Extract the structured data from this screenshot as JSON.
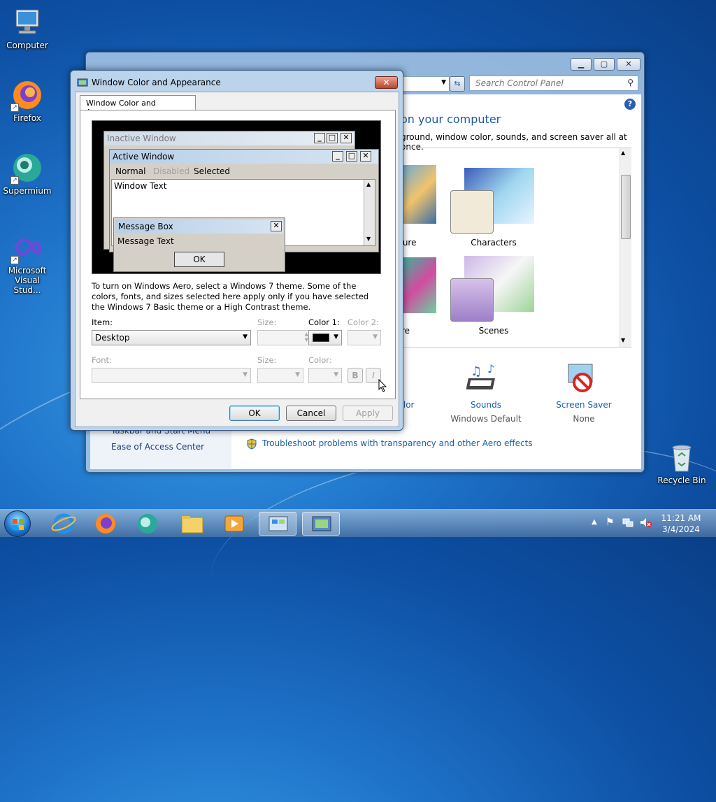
{
  "desktop": {
    "icons": [
      {
        "label": "Computer"
      },
      {
        "label": "Firefox"
      },
      {
        "label": "Supermium"
      },
      {
        "label": "Microsoft Visual Stud..."
      },
      {
        "label": "Recycle Bin"
      }
    ]
  },
  "control_panel": {
    "search_placeholder": "Search Control Panel",
    "heading": "on your computer",
    "subheading": "ground, window color, sounds, and screen saver all at once.",
    "themes": [
      {
        "label": "cture"
      },
      {
        "label": "Characters"
      },
      {
        "label": "re"
      },
      {
        "label": "Scenes"
      }
    ],
    "bottom_items": [
      {
        "title": "olor",
        "sub": ""
      },
      {
        "title": "Sounds",
        "sub": "Windows Default"
      },
      {
        "title": "Screen Saver",
        "sub": "None"
      }
    ],
    "left_links": [
      "Taskbar and Start Menu",
      "Ease of Access Center"
    ],
    "troubleshoot_link": "Troubleshoot problems with transparency and other Aero effects"
  },
  "dialog": {
    "title": "Window Color and Appearance",
    "tab_label": "Window Color and Appearance",
    "preview": {
      "inactive_title": "Inactive Window",
      "active_title": "Active Window",
      "menu_normal": "Normal",
      "menu_disabled": "Disabled",
      "menu_selected": "Selected",
      "window_text": "Window Text",
      "msgbox_title": "Message Box",
      "msgbox_text": "Message Text",
      "ok": "OK"
    },
    "description": "To turn on Windows Aero, select a Windows 7 theme.  Some of the colors, fonts, and sizes selected here apply only if you have selected the Windows 7 Basic theme or a High Contrast theme.",
    "item_label": "Item:",
    "item_value": "Desktop",
    "size_label": "Size:",
    "color1_label": "Color 1:",
    "color1_value": "#000000",
    "color2_label": "Color 2:",
    "font_label": "Font:",
    "font_size_label": "Size:",
    "font_color_label": "Color:",
    "bold": "B",
    "italic": "I",
    "ok": "OK",
    "cancel": "Cancel",
    "apply": "Apply"
  },
  "taskbar": {
    "time": "11:21 AM",
    "date": "3/4/2024"
  }
}
